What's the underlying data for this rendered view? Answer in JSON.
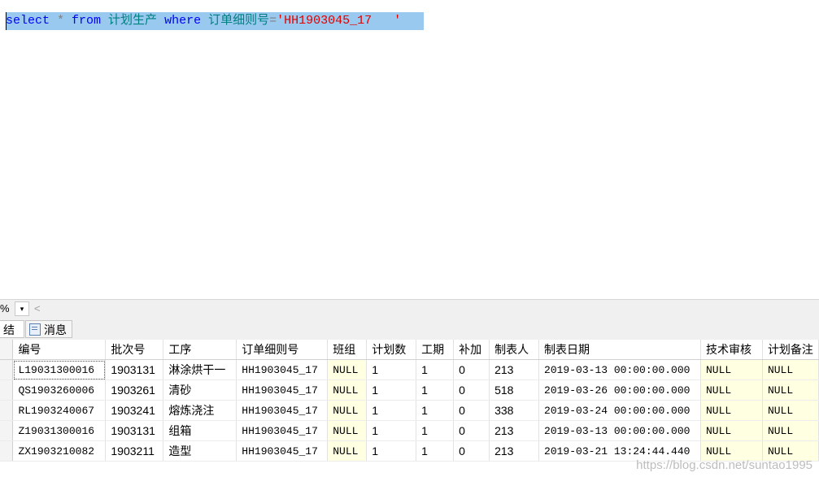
{
  "editor": {
    "tokens": [
      {
        "text": "select",
        "cls": "kw"
      },
      {
        "text": " * ",
        "cls": "op"
      },
      {
        "text": "from",
        "cls": "kw"
      },
      {
        "text": " 计划生产 ",
        "cls": "id"
      },
      {
        "text": "where",
        "cls": "kw"
      },
      {
        "text": " 订单细则号",
        "cls": "id"
      },
      {
        "text": "=",
        "cls": "op"
      },
      {
        "text": "'HH1903045_17   '",
        "cls": "str"
      }
    ]
  },
  "zoom": {
    "value": "%",
    "dropdown_icon": "▾",
    "scroll_left_icon": "<"
  },
  "tabs": [
    {
      "label": "结果"
    },
    {
      "label": "消息",
      "icon": "messages-icon"
    }
  ],
  "grid": {
    "columns": [
      "编号",
      "批次号",
      "工序",
      "订单细则号",
      "班组",
      "计划数",
      "工期",
      "补加",
      "制表人",
      "制表日期",
      "技术审核",
      "计划备注"
    ],
    "rows": [
      [
        "L19031300016",
        "1903131",
        "淋涂烘干一",
        "HH1903045_17",
        "NULL",
        "1",
        "1",
        "0",
        "213",
        "2019-03-13 00:00:00.000",
        "NULL",
        "NULL"
      ],
      [
        "QS1903260006",
        "1903261",
        "清砂",
        "HH1903045_17",
        "NULL",
        "1",
        "1",
        "0",
        "518",
        "2019-03-26 00:00:00.000",
        "NULL",
        "NULL"
      ],
      [
        "RL1903240067",
        "1903241",
        "熔炼浇注",
        "HH1903045_17",
        "NULL",
        "1",
        "1",
        "0",
        "338",
        "2019-03-24 00:00:00.000",
        "NULL",
        "NULL"
      ],
      [
        "Z19031300016",
        "1903131",
        "组箱",
        "HH1903045_17",
        "NULL",
        "1",
        "1",
        "0",
        "213",
        "2019-03-13 00:00:00.000",
        "NULL",
        "NULL"
      ],
      [
        "ZX1903210082",
        "1903211",
        "造型",
        "HH1903045_17",
        "NULL",
        "1",
        "1",
        "0",
        "213",
        "2019-03-21 13:24:44.440",
        "NULL",
        "NULL"
      ]
    ]
  },
  "watermark": "https://blog.csdn.net/suntao1995",
  "colors": {
    "keyword": "#0000ff",
    "identifier": "#008080",
    "string": "#e00000",
    "selection": "#99c9ef",
    "null_cell": "#ffffe1"
  }
}
